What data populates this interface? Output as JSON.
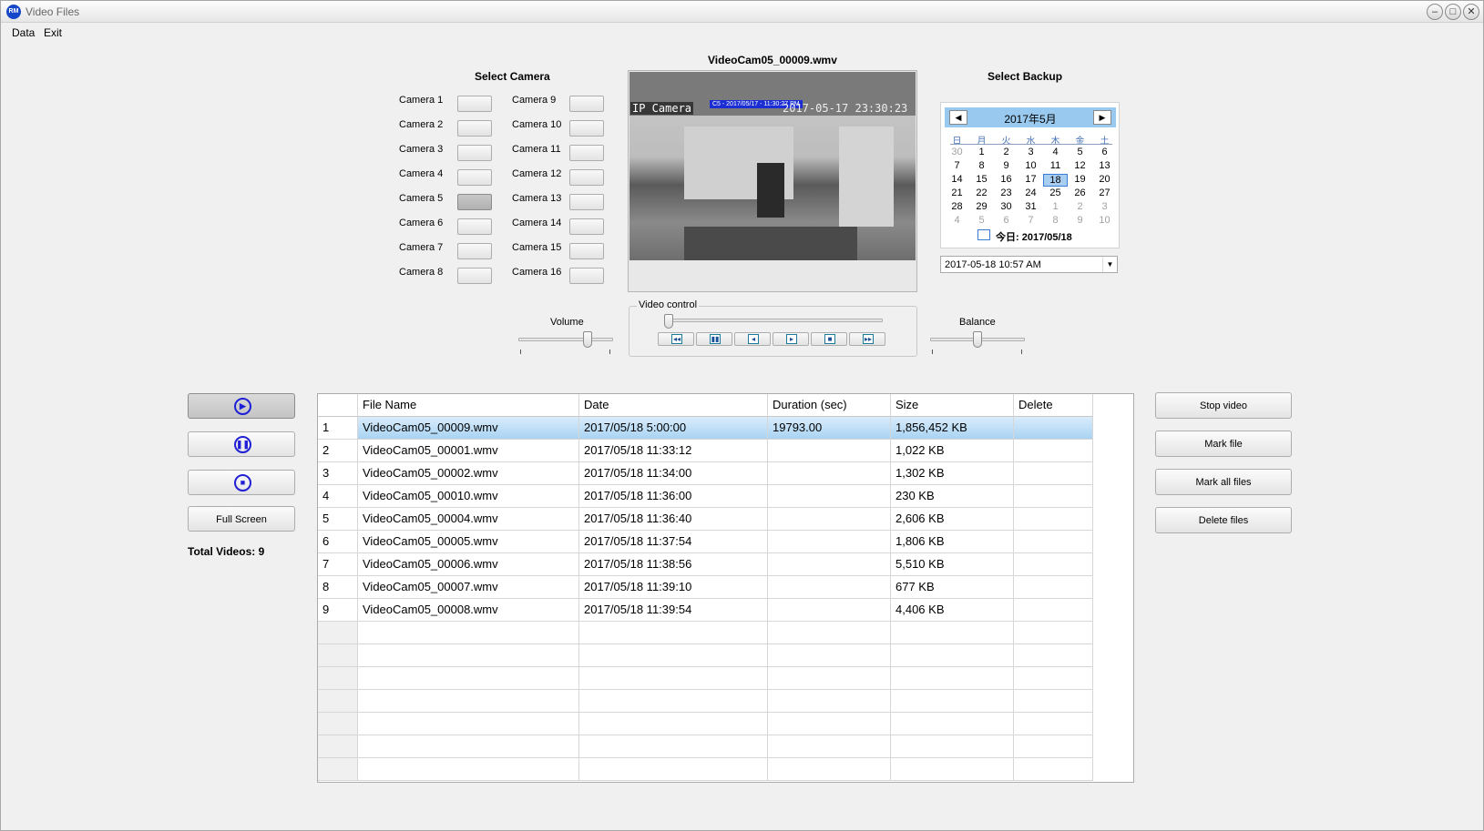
{
  "window": {
    "title": "Video Files",
    "logo": "RM",
    "controls": [
      "minimize-icon",
      "maximize-icon",
      "close-icon"
    ]
  },
  "menu": [
    {
      "label": "Data"
    },
    {
      "label": "Exit"
    }
  ],
  "select_camera": {
    "title": "Select Camera",
    "left": [
      "Camera 1",
      "Camera 2",
      "Camera 3",
      "Camera 4",
      "Camera 5",
      "Camera 6",
      "Camera 7",
      "Camera 8"
    ],
    "right": [
      "Camera 9",
      "Camera 10",
      "Camera 11",
      "Camera 12",
      "Camera 13",
      "Camera 14",
      "Camera 15",
      "Camera 16"
    ],
    "active": "Camera 5"
  },
  "video": {
    "filename": "VideoCam05_00009.wmv",
    "overlay_label": "IP Camera",
    "overlay_timestamp": "2017-05-17 23:30:23",
    "overlay_bluebar": "C5 - 2017/05/17 - 11:30:27 PM"
  },
  "volume": {
    "label": "Volume",
    "value": 0.75
  },
  "balance": {
    "label": "Balance",
    "value": 0.5
  },
  "video_control": {
    "label": "Video control",
    "position": 0.0,
    "buttons": [
      "rewind-icon",
      "pause-icon",
      "step-back-icon",
      "play-icon",
      "stop-icon",
      "forward-icon"
    ],
    "glyphs": [
      "◂◂",
      "▮▮",
      "◂",
      "▸",
      "■",
      "▸▸"
    ]
  },
  "backup": {
    "title": "Select Backup",
    "calendar": {
      "month_label": "2017年5月",
      "prev": "◀",
      "next": "▶",
      "dow": [
        "日",
        "月",
        "火",
        "水",
        "木",
        "金",
        "土"
      ],
      "weeks": [
        [
          "30",
          "1",
          "2",
          "3",
          "4",
          "5",
          "6"
        ],
        [
          "7",
          "8",
          "9",
          "10",
          "11",
          "12",
          "13"
        ],
        [
          "14",
          "15",
          "16",
          "17",
          "18",
          "19",
          "20"
        ],
        [
          "21",
          "22",
          "23",
          "24",
          "25",
          "26",
          "27"
        ],
        [
          "28",
          "29",
          "30",
          "31",
          "1",
          "2",
          "3"
        ],
        [
          "4",
          "5",
          "6",
          "7",
          "8",
          "9",
          "10"
        ]
      ],
      "selected": "18",
      "today_label": "今日: 2017/05/18"
    },
    "datetime": "2017-05-18  10:57  AM"
  },
  "side_buttons": [
    {
      "name": "play",
      "glyph": "▶"
    },
    {
      "name": "pause",
      "glyph": "❚❚"
    },
    {
      "name": "stop",
      "glyph": "■"
    }
  ],
  "full_screen_label": "Full Screen",
  "total_videos": "Total Videos:  9",
  "table": {
    "columns": [
      "",
      "File Name",
      "Date",
      "Duration (sec)",
      "Size",
      "Delete"
    ],
    "rows": [
      [
        "1",
        "VideoCam05_00009.wmv",
        "2017/05/18 5:00:00",
        "19793.00",
        "1,856,452 KB",
        ""
      ],
      [
        "2",
        "VideoCam05_00001.wmv",
        "2017/05/18 11:33:12",
        "",
        "1,022 KB",
        ""
      ],
      [
        "3",
        "VideoCam05_00002.wmv",
        "2017/05/18 11:34:00",
        "",
        "1,302 KB",
        ""
      ],
      [
        "4",
        "VideoCam05_00010.wmv",
        "2017/05/18 11:36:00",
        "",
        "230 KB",
        ""
      ],
      [
        "5",
        "VideoCam05_00004.wmv",
        "2017/05/18 11:36:40",
        "",
        "2,606 KB",
        ""
      ],
      [
        "6",
        "VideoCam05_00005.wmv",
        "2017/05/18 11:37:54",
        "",
        "1,806 KB",
        ""
      ],
      [
        "7",
        "VideoCam05_00006.wmv",
        "2017/05/18 11:38:56",
        "",
        "5,510 KB",
        ""
      ],
      [
        "8",
        "VideoCam05_00007.wmv",
        "2017/05/18 11:39:10",
        "",
        "677 KB",
        ""
      ],
      [
        "9",
        "VideoCam05_00008.wmv",
        "2017/05/18 11:39:54",
        "",
        "4,406 KB",
        ""
      ]
    ],
    "empty_rows": 7,
    "selected_row": 0
  },
  "right_buttons": [
    "Stop video",
    "Mark file",
    "Mark all files",
    "Delete files"
  ]
}
